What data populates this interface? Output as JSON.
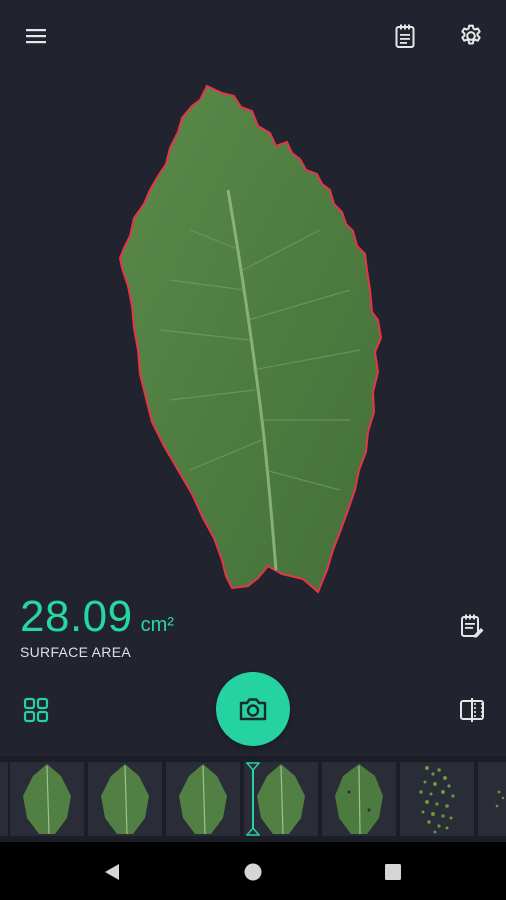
{
  "app": {
    "accent_color": "#25d3a0",
    "background_color": "#21232f"
  },
  "toolbar": {
    "menu_icon": "hamburger-menu-icon",
    "notes_icon": "clipboard-notes-icon",
    "settings_icon": "gear-icon"
  },
  "measurement": {
    "value": "28.09",
    "unit": "cm²",
    "label": "SURFACE AREA",
    "edit_icon": "edit-note-icon",
    "outline_color": "#e8344a"
  },
  "controls": {
    "gallery_icon": "grid-icon",
    "capture_icon": "camera-icon",
    "compare_icon": "compare-split-icon"
  },
  "filmstrip": {
    "thumbnails": [
      {
        "name": "thumb-1",
        "kind": "leaf"
      },
      {
        "name": "thumb-2",
        "kind": "leaf"
      },
      {
        "name": "thumb-3",
        "kind": "leaf"
      },
      {
        "name": "thumb-4",
        "kind": "leaf"
      },
      {
        "name": "thumb-5",
        "kind": "leaf"
      },
      {
        "name": "thumb-6",
        "kind": "leaf-noisy"
      },
      {
        "name": "thumb-7",
        "kind": "leaf-noisy"
      }
    ],
    "selected_index": 3
  },
  "system_nav": {
    "back_icon": "triangle-back-icon",
    "home_icon": "circle-home-icon",
    "recents_icon": "square-recents-icon"
  }
}
